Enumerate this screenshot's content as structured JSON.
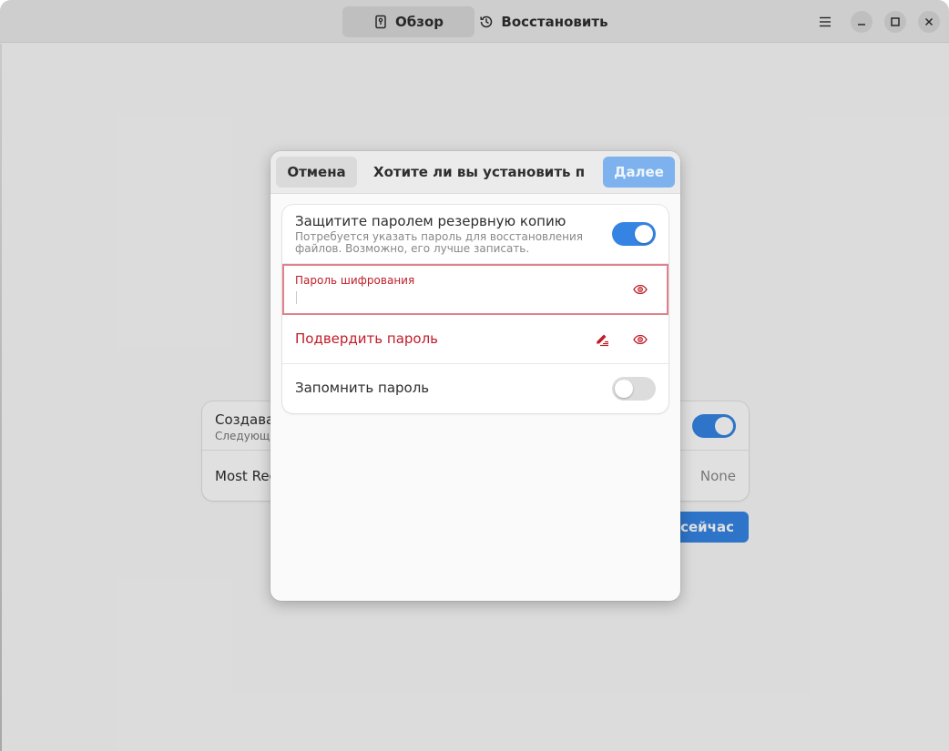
{
  "headerbar": {
    "tab_overview": "Обзор",
    "tab_restore": "Восстановить",
    "menu_icon": "hamburger-menu-icon",
    "minimize_icon": "minimize-icon",
    "maximize_icon": "maximize-icon",
    "close_icon": "close-icon"
  },
  "main": {
    "auto_backup_title": "Создават",
    "auto_backup_sub": "Следующе",
    "recent_label": "Most Rec",
    "recent_value": "None",
    "backup_now_label": "о сейчас"
  },
  "dialog": {
    "cancel_label": "Отмена",
    "title": "Хотите ли вы установить паро…",
    "next_label": "Далее",
    "protect": {
      "title": "Защитите паролем резервную копию",
      "subtitle": "Потребуется указать пароль для восстановления файлов. Возможно, его лучше записать.",
      "enabled": true
    },
    "password_field": {
      "label": "Пароль шифрования",
      "value": ""
    },
    "confirm_field": {
      "label": "Подвердить пароль"
    },
    "remember": {
      "label": "Запомнить пароль",
      "enabled": false
    }
  },
  "colors": {
    "accent": "#3584e4",
    "error": "#c01c28",
    "error_border": "#e0828d"
  }
}
